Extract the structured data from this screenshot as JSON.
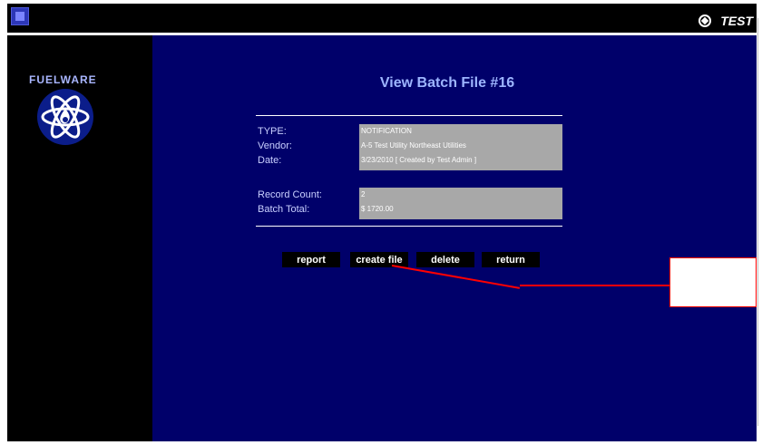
{
  "brand": {
    "label": "TEST"
  },
  "sidebar": {
    "logo_text": "FUELWARE"
  },
  "main": {
    "title": "View Batch File #16",
    "fields": [
      {
        "label": "TYPE:",
        "value": "NOTIFICATION"
      },
      {
        "label": "Vendor:",
        "value": "A-5 Test Utility Northeast Utilities"
      },
      {
        "label": "Date:",
        "value": "3/23/2010 [ Created by Test Admin ]"
      }
    ],
    "record_fields": [
      {
        "label": "Record Count:",
        "value": "2"
      },
      {
        "label": "Batch Total:",
        "value": "$ 1720.00"
      }
    ],
    "buttons": {
      "report": "report",
      "create_file": "create file",
      "delete": "delete",
      "return": "return"
    }
  }
}
